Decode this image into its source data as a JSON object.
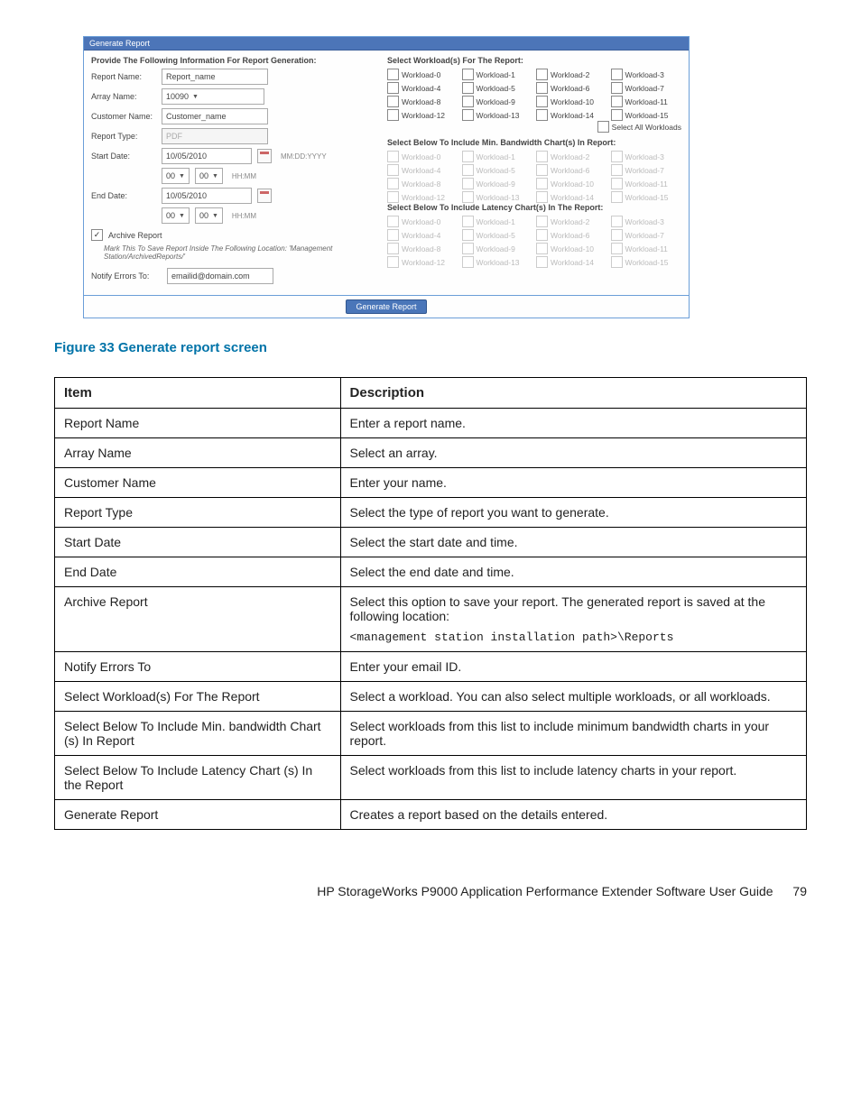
{
  "shot": {
    "title": "Generate Report",
    "left_heading": "Provide The Following Information For Report Generation:",
    "fields": {
      "report_name": {
        "label": "Report Name:",
        "value": "Report_name"
      },
      "array_name": {
        "label": "Array Name:",
        "value": "10090"
      },
      "customer_name": {
        "label": "Customer Name:",
        "value": "Customer_name"
      },
      "report_type": {
        "label": "Report Type:",
        "value": "PDF"
      },
      "start_date": {
        "label": "Start Date:",
        "value": "10/05/2010",
        "hh": "00",
        "mm": "00",
        "fmt": "MM:DD:YYYY",
        "tfmt": "HH:MM"
      },
      "end_date": {
        "label": "End Date:",
        "value": "10/05/2010",
        "hh": "00",
        "mm": "00",
        "tfmt": "HH:MM"
      },
      "archive": {
        "label": "Archive Report",
        "checked": true,
        "note": "Mark This To Save Report Inside The Following Location: 'Management Station/ArchivedReports/'"
      },
      "notify": {
        "label": "Notify Errors To:",
        "value": "emailid@domain.com"
      }
    },
    "right": {
      "sec1": "Select Workload(s) For The Report:",
      "sec2": "Select Below To Include Min. Bandwidth Chart(s) In Report:",
      "sec3": "Select Below To Include Latency Chart(s) In The Report:",
      "select_all": "Select All Workloads",
      "workloads": [
        "Workload-0",
        "Workload-1",
        "Workload-2",
        "Workload-3",
        "Workload-4",
        "Workload-5",
        "Workload-6",
        "Workload-7",
        "Workload-8",
        "Workload-9",
        "Workload-10",
        "Workload-11",
        "Workload-12",
        "Workload-13",
        "Workload-14",
        "Workload-15"
      ]
    },
    "button": "Generate Report"
  },
  "caption": "Figure 33 Generate report screen",
  "table": {
    "headers": {
      "item": "Item",
      "desc": "Description"
    },
    "rows": [
      {
        "item": "Report Name",
        "desc": "Enter a report name."
      },
      {
        "item": "Array Name",
        "desc": "Select an array."
      },
      {
        "item": "Customer Name",
        "desc": "Enter your name."
      },
      {
        "item": "Report Type",
        "desc": "Select the type of report you want to generate."
      },
      {
        "item": "Start Date",
        "desc": "Select the start date and time."
      },
      {
        "item": "End Date",
        "desc": "Select the end date and time."
      },
      {
        "item": "Archive Report",
        "desc": "Select this option to save your report. The generated report is saved at the following location:",
        "code": "<management station installation path>\\Reports"
      },
      {
        "item": "Notify Errors To",
        "desc": "Enter your email ID."
      },
      {
        "item": "Select Workload(s) For The Report",
        "desc": "Select a workload. You can also select multiple workloads, or all workloads."
      },
      {
        "item": "Select Below To Include Min. bandwidth Chart (s) In Report",
        "desc": "Select workloads from this list to include minimum bandwidth charts in your report."
      },
      {
        "item": "Select Below To Include Latency Chart (s) In the Report",
        "desc": "Select workloads from this list to include latency charts in your report."
      },
      {
        "item": "Generate Report",
        "desc": "Creates a report based on the details entered."
      }
    ]
  },
  "footer": {
    "text": "HP StorageWorks P9000 Application Performance Extender Software User Guide",
    "page": "79"
  }
}
